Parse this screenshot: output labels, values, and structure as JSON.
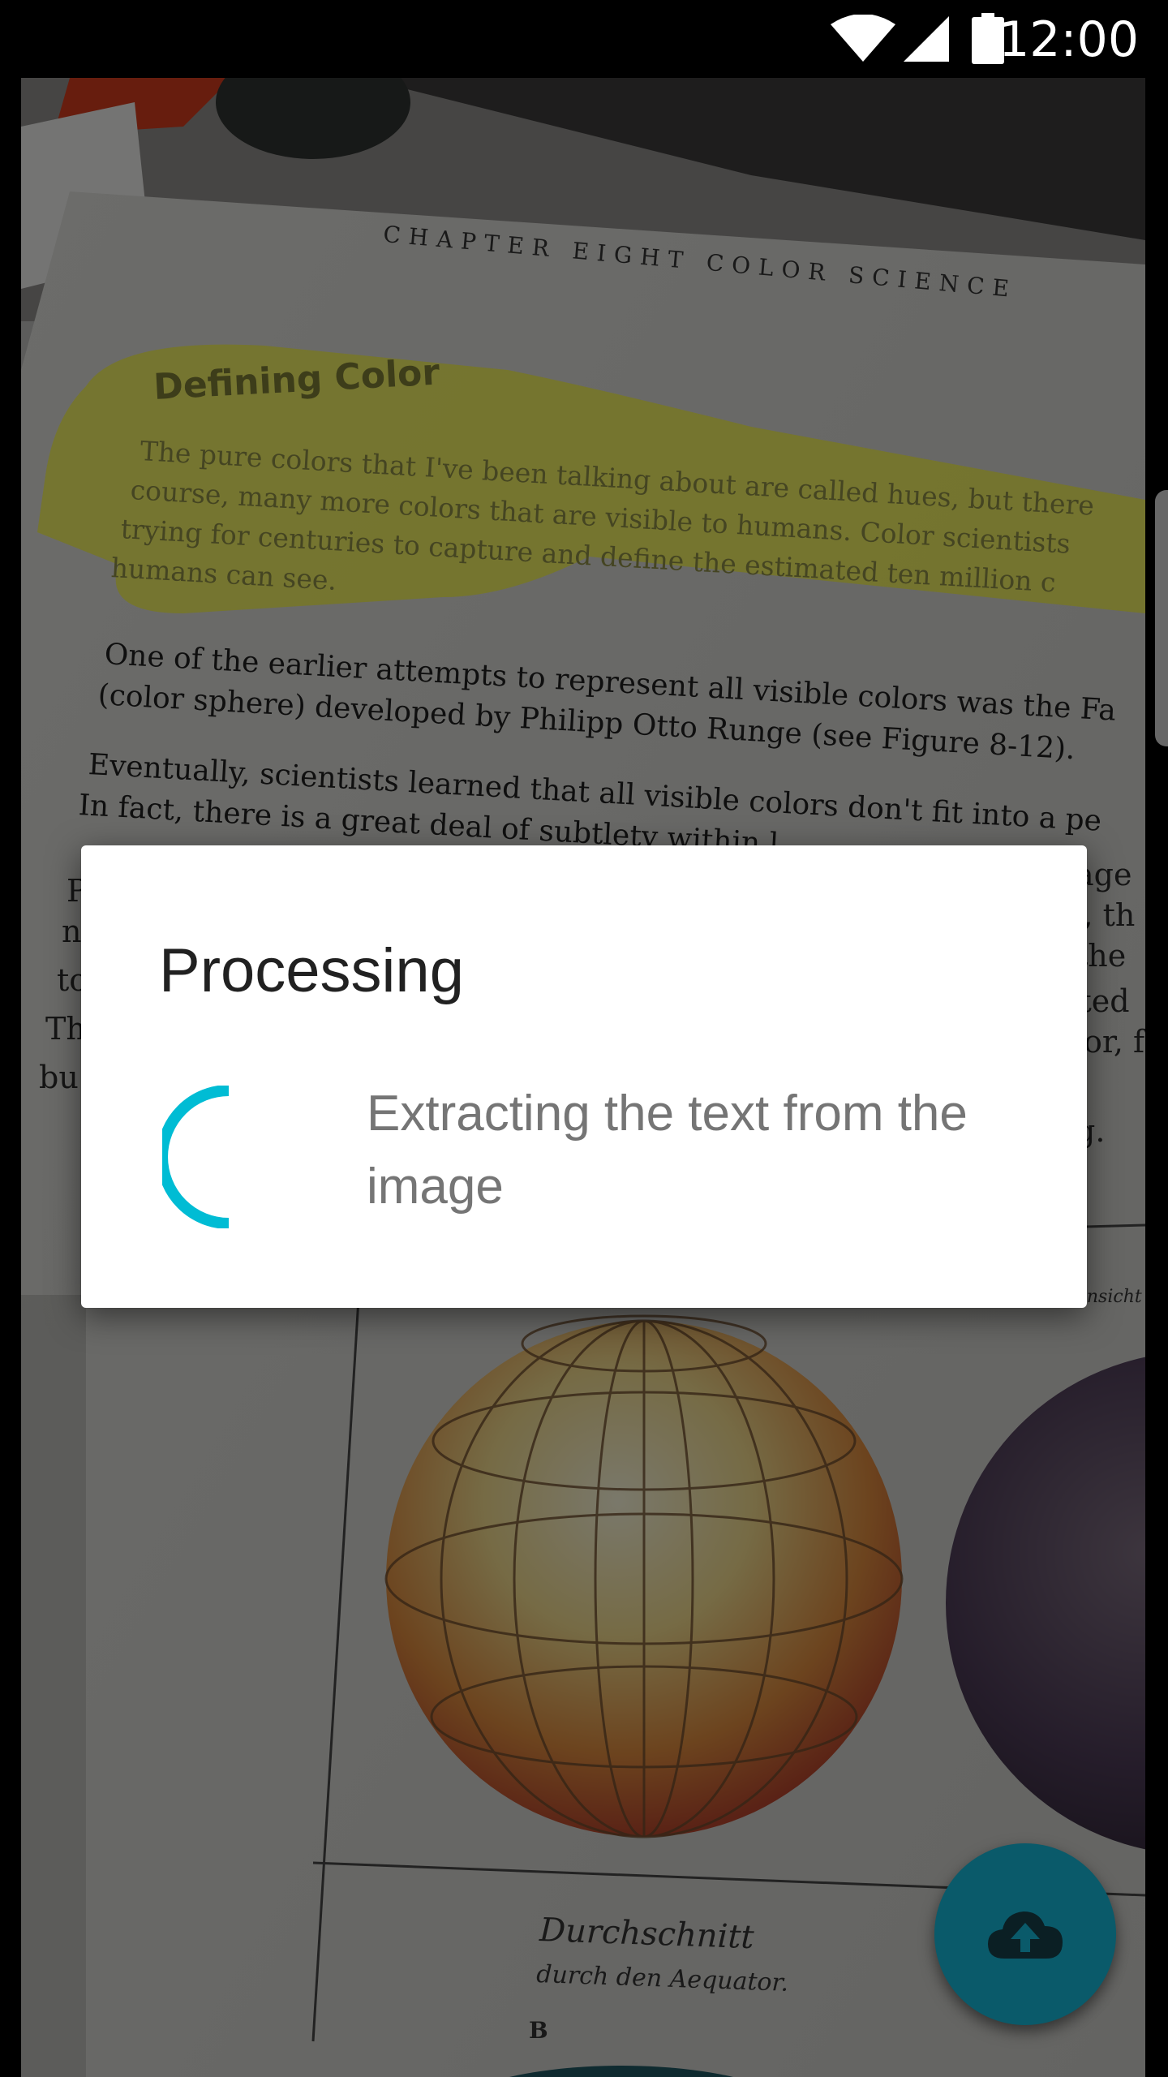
{
  "status_bar": {
    "time": "12:00",
    "icons": [
      "wifi-icon",
      "cell-signal-icon",
      "battery-icon"
    ]
  },
  "photo": {
    "chapter_heading": "CHAPTER EIGHT  COLOR SCIENCE",
    "highlighted_heading": "Defining Color",
    "highlighted_lines": [
      "The pure colors that I've been talking about are called hues, but there",
      "course, many more colors that are visible to humans. Color scientists",
      "trying for centuries to capture and define the estimated ten million c",
      "humans can see."
    ],
    "body_lines": [
      "One of the earlier attempts to represent all visible colors was the Fa",
      "(color sphere) developed by Philipp Otto Runge (see Figure 8-12).",
      "Eventually, scientists learned that all visible colors don't fit into a pe",
      "In fact, there is a great deal of subtlety within l"
    ],
    "right_edge_words": [
      "age",
      "s, th",
      "the",
      "nted",
      "or, f",
      "g."
    ],
    "left_edge_letters": [
      "P",
      "n",
      "to",
      "Th",
      "bu"
    ],
    "figure_caption": "Ansicht",
    "script_caption_1": "Durchschnitt",
    "script_caption_2": "durch den Aequator.",
    "figure_label": "B"
  },
  "dialog": {
    "title": "Processing",
    "message": "Extracting the text from the image"
  },
  "fab": {
    "icon": "cloud-upload-icon"
  },
  "colors": {
    "spinner": "#00bcd4",
    "fab_background": "#0a5a6a",
    "highlight": "#f2f23a"
  }
}
